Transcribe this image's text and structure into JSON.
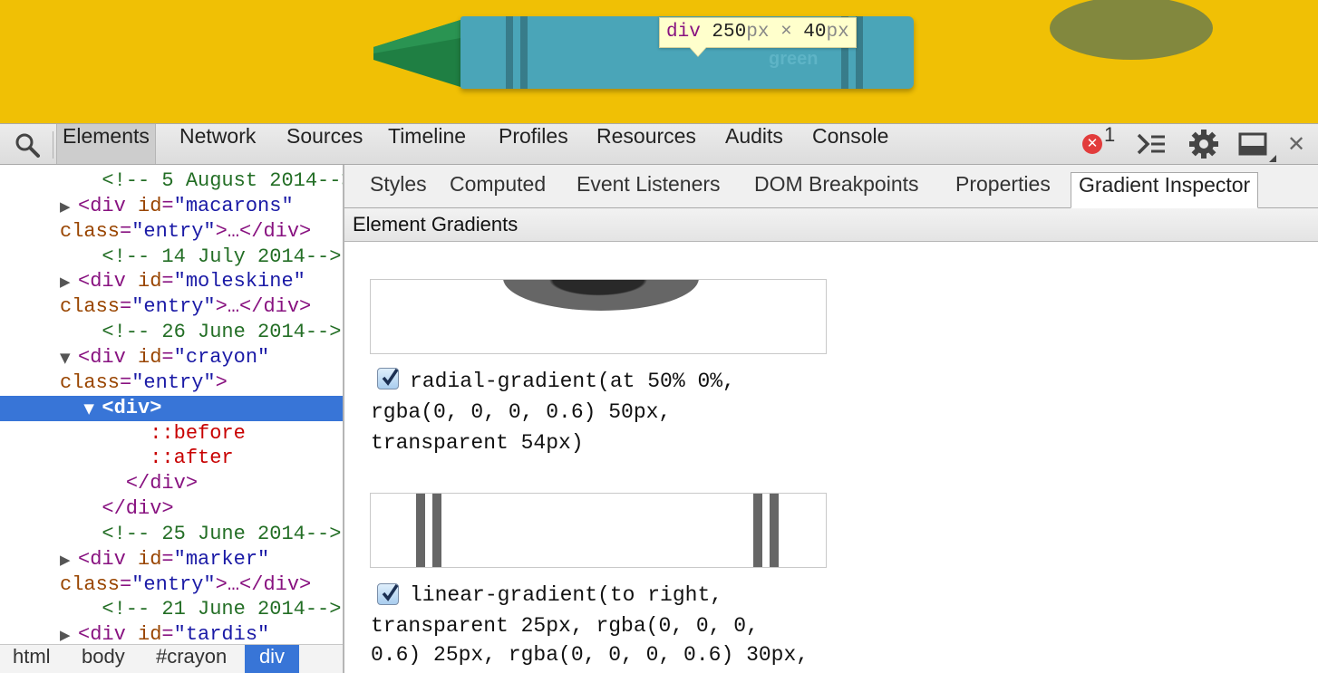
{
  "preview": {
    "crayon_label": "green",
    "tooltip": {
      "tag": "div",
      "width": "250",
      "width_unit": "px",
      "times": "×",
      "height": "40",
      "height_unit": "px"
    },
    "colors": {
      "background": "#f0c005",
      "crayon_body": "#4aa5b8",
      "crayon_tip": "#1f7f43"
    }
  },
  "toolbar": {
    "tabs": [
      "Elements",
      "Network",
      "Sources",
      "Timeline",
      "Profiles",
      "Resources",
      "Audits",
      "Console"
    ],
    "active_tab": "Elements",
    "error_count": "1",
    "icons": [
      "search-icon",
      "error-icon",
      "console-drawer-icon",
      "gear-icon",
      "dock-side-icon",
      "close-icon"
    ]
  },
  "tree": {
    "lines": [
      {
        "indent": "  ",
        "arrow": "",
        "parts": [
          [
            "cm",
            "<!-- 5 August 2014-->"
          ]
        ]
      },
      {
        "indent": "",
        "arrow": "▶",
        "parts": [
          [
            "tag",
            "<div "
          ],
          [
            "an",
            "id"
          ],
          [
            "tag",
            "="
          ],
          [
            "av",
            "\"macarons\""
          ]
        ]
      },
      {
        "indent": "",
        "arrow": "",
        "parts": [
          [
            "an",
            "class"
          ],
          [
            "tag",
            "="
          ],
          [
            "av",
            "\"entry\""
          ],
          [
            "tag",
            ">…</div>"
          ]
        ]
      },
      {
        "indent": "  ",
        "arrow": "",
        "parts": [
          [
            "cm",
            "<!-- 14 July 2014-->"
          ]
        ]
      },
      {
        "indent": "",
        "arrow": "▶",
        "parts": [
          [
            "tag",
            "<div "
          ],
          [
            "an",
            "id"
          ],
          [
            "tag",
            "="
          ],
          [
            "av",
            "\"moleskine\""
          ]
        ]
      },
      {
        "indent": "",
        "arrow": "",
        "parts": [
          [
            "an",
            "class"
          ],
          [
            "tag",
            "="
          ],
          [
            "av",
            "\"entry\""
          ],
          [
            "tag",
            ">…</div>"
          ]
        ]
      },
      {
        "indent": "  ",
        "arrow": "",
        "parts": [
          [
            "cm",
            "<!-- 26 June 2014-->"
          ]
        ]
      },
      {
        "indent": "",
        "arrow": "▼",
        "parts": [
          [
            "tag",
            "<div "
          ],
          [
            "an",
            "id"
          ],
          [
            "tag",
            "="
          ],
          [
            "av",
            "\"crayon\""
          ]
        ]
      },
      {
        "indent": "",
        "arrow": "",
        "parts": [
          [
            "an",
            "class"
          ],
          [
            "tag",
            "="
          ],
          [
            "av",
            "\"entry\""
          ],
          [
            "tag",
            ">"
          ]
        ]
      },
      {
        "indent": "  ",
        "arrow": "▼",
        "parts": [
          [
            "tag",
            "<div>"
          ]
        ],
        "selected": true
      },
      {
        "indent": "      ",
        "arrow": "",
        "parts": [
          [
            "ps",
            "::before"
          ]
        ]
      },
      {
        "indent": "      ",
        "arrow": "",
        "parts": [
          [
            "ps",
            "::after"
          ]
        ]
      },
      {
        "indent": "    ",
        "arrow": "",
        "parts": [
          [
            "tag",
            "</div>"
          ]
        ]
      },
      {
        "indent": "  ",
        "arrow": "",
        "parts": [
          [
            "tag",
            "</div>"
          ]
        ]
      },
      {
        "indent": "  ",
        "arrow": "",
        "parts": [
          [
            "cm",
            "<!-- 25 June 2014-->"
          ]
        ]
      },
      {
        "indent": "",
        "arrow": "▶",
        "parts": [
          [
            "tag",
            "<div "
          ],
          [
            "an",
            "id"
          ],
          [
            "tag",
            "="
          ],
          [
            "av",
            "\"marker\""
          ]
        ]
      },
      {
        "indent": "",
        "arrow": "",
        "parts": [
          [
            "an",
            "class"
          ],
          [
            "tag",
            "="
          ],
          [
            "av",
            "\"entry\""
          ],
          [
            "tag",
            ">…</div>"
          ]
        ]
      },
      {
        "indent": "  ",
        "arrow": "",
        "parts": [
          [
            "cm",
            "<!-- 21 June 2014-->"
          ]
        ]
      },
      {
        "indent": "",
        "arrow": "▶",
        "parts": [
          [
            "tag",
            "<div "
          ],
          [
            "an",
            "id"
          ],
          [
            "tag",
            "="
          ],
          [
            "av",
            "\"tardis\""
          ]
        ]
      }
    ]
  },
  "breadcrumbs": [
    "html",
    "body",
    "#crayon",
    "div"
  ],
  "sidebar": {
    "tabs": [
      "Styles",
      "Computed",
      "Event Listeners",
      "DOM Breakpoints",
      "Properties",
      "Gradient Inspector"
    ],
    "active_tab": "Gradient Inspector",
    "pane_title": "Element Gradients",
    "gradients": [
      {
        "enabled": true,
        "lines": [
          "radial-gradient(at 50% 0%,",
          "rgba(0, 0, 0, 0.6) 50px,",
          "transparent 54px)"
        ]
      },
      {
        "enabled": true,
        "lines": [
          "linear-gradient(to right,",
          "transparent 25px, rgba(0, 0, 0,",
          "0.6) 25px, rgba(0, 0, 0, 0.6) 30px,"
        ]
      }
    ]
  }
}
